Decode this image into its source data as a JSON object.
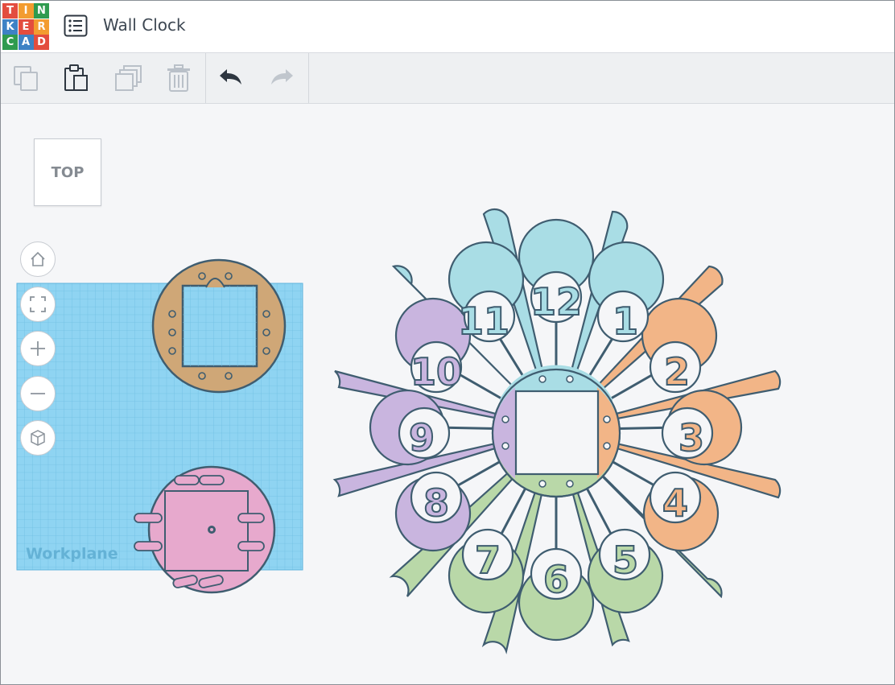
{
  "app": {
    "logo_letters": [
      "T",
      "I",
      "N",
      "K",
      "E",
      "R",
      "C",
      "A",
      "D"
    ],
    "logo_colors": [
      "#e34d3f",
      "#f39c30",
      "#2f9b4f",
      "#3e82c5",
      "#e34d3f",
      "#f39c30",
      "#2f9b4f",
      "#3e82c5",
      "#e34d3f"
    ],
    "menu_icon": "list-icon",
    "design_title": "Wall Clock"
  },
  "toolbar": {
    "buttons": [
      {
        "name": "copy",
        "icon": "copy-icon",
        "enabled": false
      },
      {
        "name": "paste",
        "icon": "paste-icon",
        "enabled": true
      },
      {
        "name": "duplicate",
        "icon": "duplicate-icon",
        "enabled": false
      },
      {
        "name": "delete",
        "icon": "trash-icon",
        "enabled": false
      },
      {
        "name": "undo",
        "icon": "undo-arrow-icon",
        "enabled": true
      },
      {
        "name": "redo",
        "icon": "redo-arrow-icon",
        "enabled": false
      }
    ]
  },
  "viewcube": {
    "face_label": "TOP"
  },
  "view_controls": [
    "home-icon",
    "fit-all-icon",
    "zoom-in-icon",
    "zoom-out-icon",
    "orthographic-view-icon"
  ],
  "workplane": {
    "label": "Workplane",
    "color": "#8fd4f2"
  },
  "clock_numbers": [
    "12",
    "1",
    "2",
    "3",
    "4",
    "5",
    "6",
    "7",
    "8",
    "9",
    "10",
    "11"
  ],
  "colors": {
    "teal": "#a9dde5",
    "orange": "#f2b587",
    "green": "#b9d8a8",
    "purple": "#c9b5df",
    "tan": "#cfa777",
    "pink": "#e7a9cd",
    "outline": "#3f5d70"
  }
}
